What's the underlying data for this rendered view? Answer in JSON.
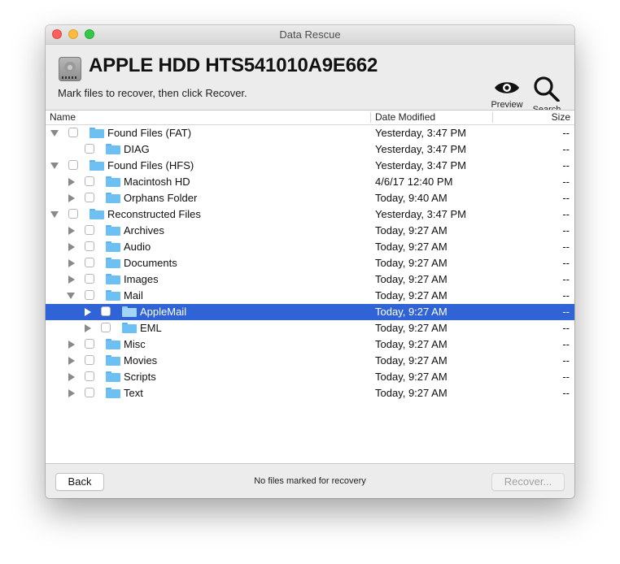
{
  "window": {
    "title": "Data Rescue",
    "controls": [
      "close",
      "minimize",
      "maximize"
    ]
  },
  "header": {
    "drive_icon": "hard-drive-icon",
    "drive_name": "APPLE HDD HTS541010A9E662",
    "instruction": "Mark files to recover, then click Recover.",
    "tools": [
      {
        "label": "Preview",
        "icon": "eye-icon"
      },
      {
        "label": "Search",
        "icon": "magnifier-icon"
      }
    ]
  },
  "table": {
    "columns": {
      "name": "Name",
      "date": "Date Modified",
      "size": "Size"
    },
    "rows": [
      {
        "name": "Found Files (FAT)",
        "date": "Yesterday, 3:47 PM",
        "size": "--",
        "level": 0,
        "disclosure": "open",
        "checked": false,
        "selected": false
      },
      {
        "name": "DIAG",
        "date": "Yesterday, 3:47 PM",
        "size": "--",
        "level": 1,
        "disclosure": "none",
        "checked": false,
        "selected": false
      },
      {
        "name": "Found Files (HFS)",
        "date": "Yesterday, 3:47 PM",
        "size": "--",
        "level": 0,
        "disclosure": "open",
        "checked": false,
        "selected": false
      },
      {
        "name": "Macintosh HD",
        "date": "4/6/17 12:40 PM",
        "size": "--",
        "level": 1,
        "disclosure": "closed",
        "checked": false,
        "selected": false
      },
      {
        "name": "Orphans Folder",
        "date": "Today, 9:40 AM",
        "size": "--",
        "level": 1,
        "disclosure": "closed",
        "checked": false,
        "selected": false
      },
      {
        "name": "Reconstructed Files",
        "date": "Yesterday, 3:47 PM",
        "size": "--",
        "level": 0,
        "disclosure": "open",
        "checked": false,
        "selected": false
      },
      {
        "name": "Archives",
        "date": "Today, 9:27 AM",
        "size": "--",
        "level": 1,
        "disclosure": "closed",
        "checked": false,
        "selected": false
      },
      {
        "name": "Audio",
        "date": "Today, 9:27 AM",
        "size": "--",
        "level": 1,
        "disclosure": "closed",
        "checked": false,
        "selected": false
      },
      {
        "name": "Documents",
        "date": "Today, 9:27 AM",
        "size": "--",
        "level": 1,
        "disclosure": "closed",
        "checked": false,
        "selected": false
      },
      {
        "name": "Images",
        "date": "Today, 9:27 AM",
        "size": "--",
        "level": 1,
        "disclosure": "closed",
        "checked": false,
        "selected": false
      },
      {
        "name": "Mail",
        "date": "Today, 9:27 AM",
        "size": "--",
        "level": 1,
        "disclosure": "open",
        "checked": false,
        "selected": false
      },
      {
        "name": "AppleMail",
        "date": "Today, 9:27 AM",
        "size": "--",
        "level": 2,
        "disclosure": "closed",
        "checked": false,
        "selected": true
      },
      {
        "name": "EML",
        "date": "Today, 9:27 AM",
        "size": "--",
        "level": 2,
        "disclosure": "closed",
        "checked": false,
        "selected": false
      },
      {
        "name": "Misc",
        "date": "Today, 9:27 AM",
        "size": "--",
        "level": 1,
        "disclosure": "closed",
        "checked": false,
        "selected": false
      },
      {
        "name": "Movies",
        "date": "Today, 9:27 AM",
        "size": "--",
        "level": 1,
        "disclosure": "closed",
        "checked": false,
        "selected": false
      },
      {
        "name": "Scripts",
        "date": "Today, 9:27 AM",
        "size": "--",
        "level": 1,
        "disclosure": "closed",
        "checked": false,
        "selected": false
      },
      {
        "name": "Text",
        "date": "Today, 9:27 AM",
        "size": "--",
        "level": 1,
        "disclosure": "closed",
        "checked": false,
        "selected": false
      }
    ]
  },
  "footer": {
    "back_label": "Back",
    "status": "No files marked for recovery",
    "recover_label": "Recover...",
    "recover_enabled": false
  },
  "colors": {
    "selection": "#2f63d6",
    "folder": "#6ec0f3"
  }
}
